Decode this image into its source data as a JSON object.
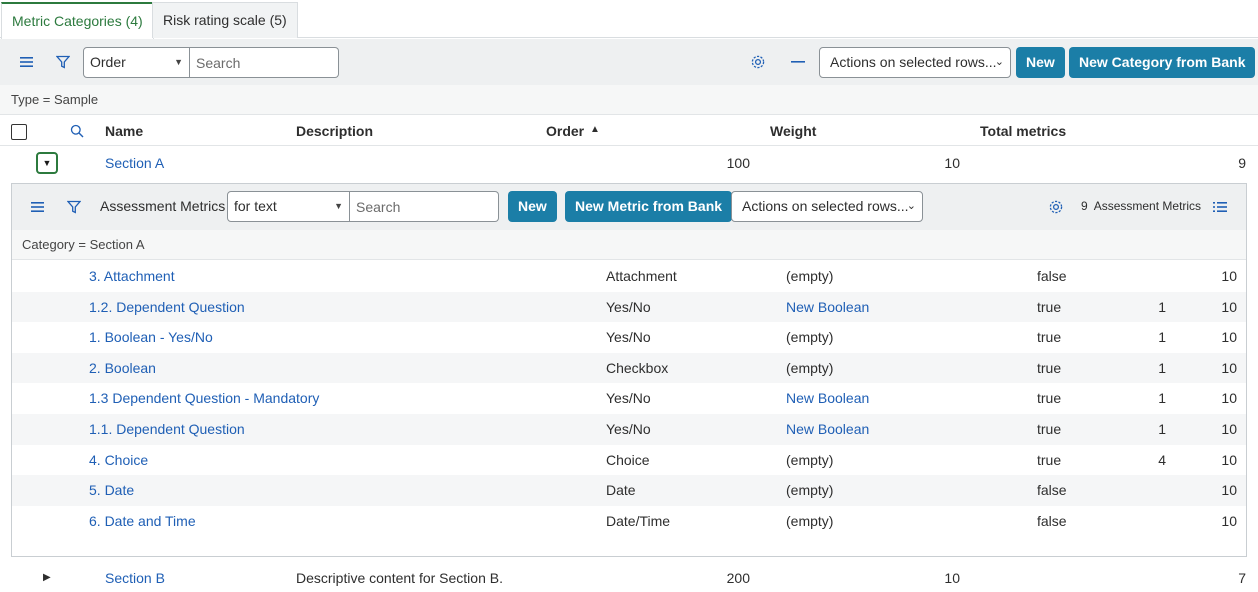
{
  "tabs": [
    {
      "label": "Metric Categories (4)",
      "active": true
    },
    {
      "label": "Risk rating scale (5)",
      "active": false
    }
  ],
  "toolbar": {
    "field_select": "Order",
    "search_placeholder": "Search",
    "actions_label": "Actions on selected rows...",
    "new_label": "New",
    "new_from_bank_label": "New Category from Bank"
  },
  "filter": "Type = Sample",
  "columns": {
    "name": "Name",
    "description": "Description",
    "order": "Order",
    "weight": "Weight",
    "total_metrics": "Total metrics"
  },
  "sort_indicator": "▲",
  "categories": [
    {
      "name": "Section A",
      "description": "",
      "order": "100",
      "weight": "10",
      "total": "9",
      "expanded": true
    },
    {
      "name": "Section B",
      "description": "Descriptive content for Section B.",
      "order": "200",
      "weight": "10",
      "total": "7",
      "expanded": false
    }
  ],
  "nested": {
    "title": "Assessment Metrics",
    "field_select": "for text",
    "search_placeholder": "Search",
    "new_label": "New",
    "new_from_bank_label": "New Metric from Bank",
    "actions_label": "Actions on selected rows...",
    "count_num": "9",
    "count_label": "Assessment Metrics",
    "filter": "Category = Section A",
    "rows": [
      {
        "name": "3. Attachment",
        "type": "Attachment",
        "depends": "(empty)",
        "depends_link": false,
        "active": "false",
        "value": "",
        "weight": "10"
      },
      {
        "name": "1.2. Dependent Question",
        "type": "Yes/No",
        "depends": "New Boolean",
        "depends_link": true,
        "active": "true",
        "value": "1",
        "weight": "10"
      },
      {
        "name": "1. Boolean - Yes/No",
        "type": "Yes/No",
        "depends": "(empty)",
        "depends_link": false,
        "active": "true",
        "value": "1",
        "weight": "10"
      },
      {
        "name": "2. Boolean",
        "type": "Checkbox",
        "depends": "(empty)",
        "depends_link": false,
        "active": "true",
        "value": "1",
        "weight": "10"
      },
      {
        "name": "1.3 Dependent Question - Mandatory",
        "type": "Yes/No",
        "depends": "New Boolean",
        "depends_link": true,
        "active": "true",
        "value": "1",
        "weight": "10"
      },
      {
        "name": "1.1. Dependent Question",
        "type": "Yes/No",
        "depends": "New Boolean",
        "depends_link": true,
        "active": "true",
        "value": "1",
        "weight": "10"
      },
      {
        "name": "4. Choice",
        "type": "Choice",
        "depends": "(empty)",
        "depends_link": false,
        "active": "true",
        "value": "4",
        "weight": "10"
      },
      {
        "name": "5. Date",
        "type": "Date",
        "depends": "(empty)",
        "depends_link": false,
        "active": "false",
        "value": "",
        "weight": "10"
      },
      {
        "name": "6. Date and Time",
        "type": "Date/Time",
        "depends": "(empty)",
        "depends_link": false,
        "active": "false",
        "value": "",
        "weight": "10"
      }
    ]
  },
  "colors": {
    "accent": "#1b7ea7",
    "link": "#1f5fb5",
    "active_tab": "#2c7a3e"
  }
}
